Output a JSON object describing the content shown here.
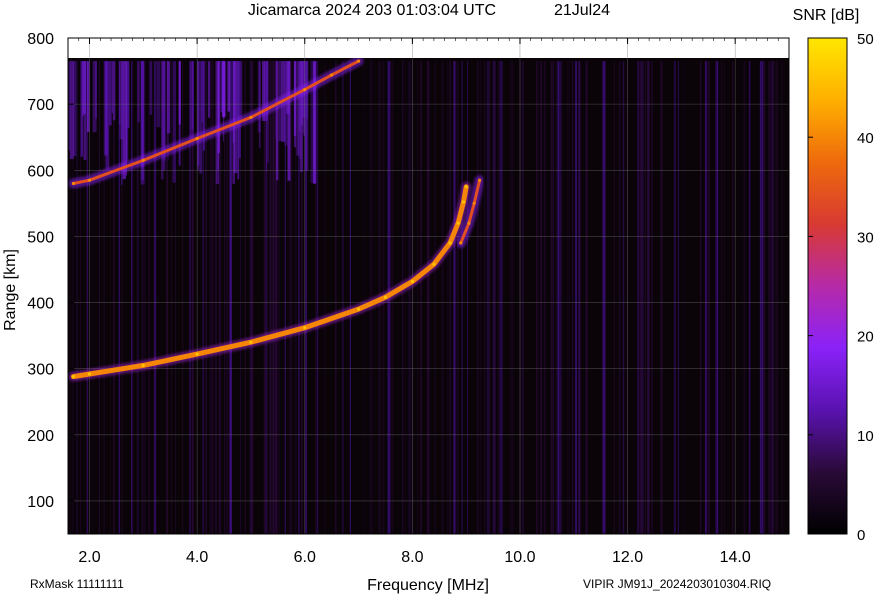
{
  "chart_data": {
    "type": "heatmap",
    "title": "Jicamarca 2024 203 01:03:04 UTC",
    "date_label": "21Jul24",
    "xlabel": "Frequency [MHz]",
    "ylabel": "Range [km]",
    "xlim": [
      1.6,
      15.0
    ],
    "ylim": [
      50,
      800
    ],
    "x_ticks": [
      2.0,
      4.0,
      6.0,
      8.0,
      10.0,
      12.0,
      14.0
    ],
    "x_tick_labels": [
      "2.0",
      "4.0",
      "6.0",
      "8.0",
      "10.0",
      "12.0",
      "14.0"
    ],
    "y_ticks": [
      100,
      200,
      300,
      400,
      500,
      600,
      700,
      800
    ],
    "y_tick_labels": [
      "100",
      "200",
      "300",
      "400",
      "500",
      "600",
      "700",
      "800"
    ],
    "data_top_km": 765,
    "grid": true,
    "colorbar": {
      "label": "SNR [dB]",
      "range": [
        0,
        50
      ],
      "ticks": [
        0,
        10,
        20,
        30,
        40,
        50
      ],
      "tick_labels": [
        "0",
        "10",
        "20",
        "30",
        "40",
        "50"
      ],
      "colors": [
        "#000000",
        "#2a0a38",
        "#5a12b0",
        "#8a22f8",
        "#b62aa8",
        "#d83a32",
        "#ee6a0c",
        "#ffb000",
        "#ffe600"
      ]
    },
    "series": [
      {
        "trace": "F-layer O-mode",
        "x": [
          1.7,
          2.0,
          3.0,
          4.0,
          5.0,
          6.0,
          7.0,
          7.5,
          8.0,
          8.4,
          8.7,
          8.85,
          8.95,
          9.0
        ],
        "y": [
          288,
          292,
          305,
          322,
          340,
          362,
          390,
          408,
          432,
          458,
          490,
          520,
          552,
          575
        ],
        "snr_db": 40
      },
      {
        "trace": "F-layer X-mode",
        "x": [
          8.9,
          9.05,
          9.15,
          9.25
        ],
        "y": [
          490,
          520,
          550,
          585
        ],
        "snr_db": 34
      },
      {
        "trace": "Multi-hop echo",
        "x": [
          1.7,
          2.0,
          3.0,
          4.0,
          5.0,
          6.0,
          6.5,
          7.0
        ],
        "y": [
          580,
          585,
          615,
          648,
          680,
          722,
          744,
          765
        ],
        "snr_db": 34
      }
    ],
    "footer_left": "RxMask 11111111",
    "footer_right": "VIPIR  JM91J_2024203010304.RIQ"
  }
}
